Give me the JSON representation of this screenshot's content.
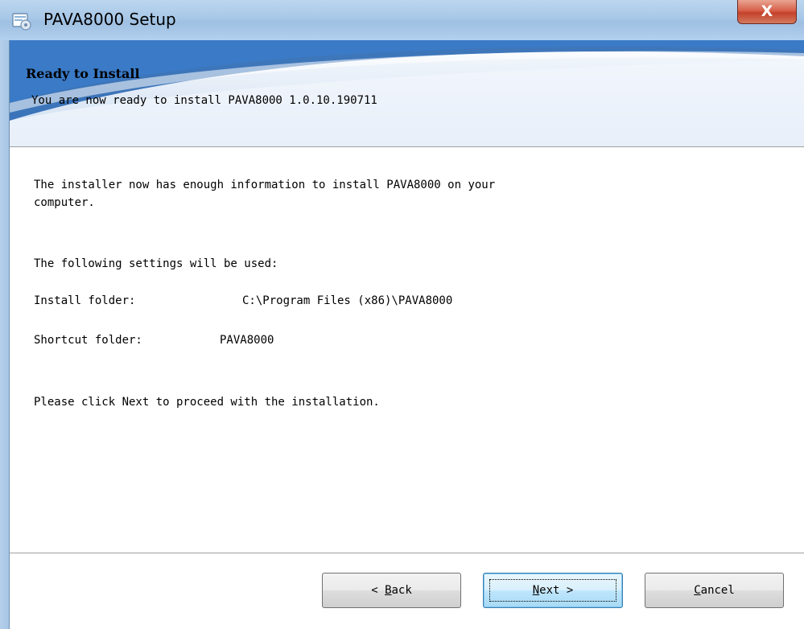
{
  "window": {
    "title": "PAVA8000 Setup",
    "icon": "installer-icon",
    "close_icon": "close-icon",
    "close_label": "X"
  },
  "header": {
    "title": "Ready to Install",
    "subtitle": "You are now ready to install PAVA8000 1.0.10.190711"
  },
  "body": {
    "intro_line1": "The installer now has enough information to install PAVA8000 on your",
    "intro_line2": "computer.",
    "settings_heading": "The following settings will be used:",
    "install_folder_label": "Install folder:",
    "install_folder_value": "C:\\Program Files (x86)\\PAVA8000",
    "shortcut_folder_label": "Shortcut folder:",
    "shortcut_folder_value": "PAVA8000",
    "proceed_text": "Please click Next to proceed with the installation."
  },
  "buttons": {
    "back": {
      "prefix": "< ",
      "mnemonic": "B",
      "rest": "ack",
      "full": "< Back"
    },
    "next": {
      "prefix": "",
      "mnemonic": "N",
      "rest": "ext >",
      "full": "Next >"
    },
    "cancel": {
      "prefix": "",
      "mnemonic": "C",
      "rest": "ancel",
      "full": "Cancel"
    }
  },
  "colors": {
    "titlebar": "#a8c8e8",
    "close_button": "#c4412b",
    "default_button_border": "#3c7fb1"
  }
}
